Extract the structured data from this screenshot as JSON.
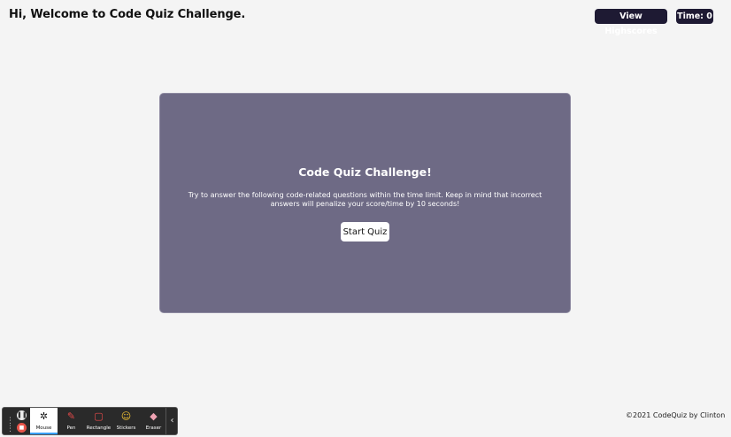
{
  "header": {
    "welcome": "Hi, Welcome to Code Quiz Challenge.",
    "highscores_label": "View Highscores",
    "time_label": "Time: 0"
  },
  "card": {
    "title": "Code Quiz Challenge!",
    "description": "Try to answer the following code-related questions within the time limit. Keep in mind that incorrect answers will penalize your score/time by 10 seconds!",
    "start_label": "Start Quiz"
  },
  "footer": {
    "text": "©2021 CodeQuiz by Clinton"
  },
  "toolbar": {
    "tools": [
      {
        "label": "Mouse",
        "icon": "mouse-pointer-icon",
        "active": true
      },
      {
        "label": "Pen",
        "icon": "pen-icon"
      },
      {
        "label": "Rectangle",
        "icon": "rectangle-icon"
      },
      {
        "label": "Stickers",
        "icon": "sticker-icon"
      },
      {
        "label": "Eraser",
        "icon": "eraser-icon"
      }
    ]
  },
  "colors": {
    "background": "#f4f4f4",
    "card": "#6e6a85",
    "button_dark": "#1e1a33"
  }
}
